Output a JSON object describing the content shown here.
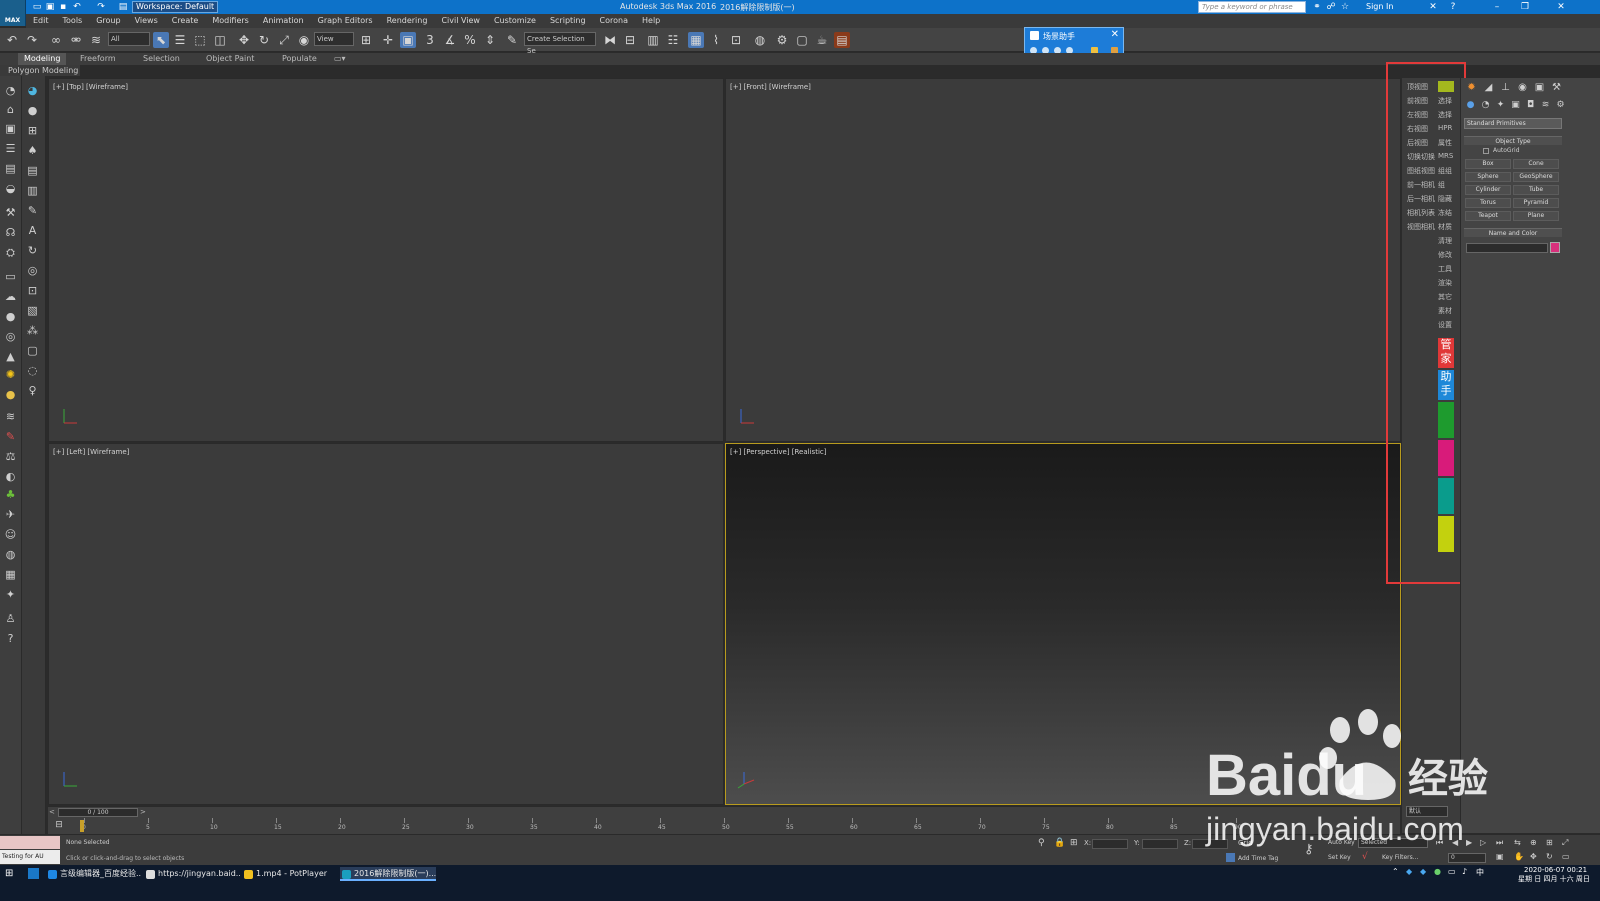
{
  "title_bar": {
    "app_name": "Autodesk 3ds Max 2016",
    "file_name": "2016解除限制版(一)",
    "workspace": "Workspace: Default",
    "search_placeholder": "Type a keyword or phrase",
    "sign_in": "Sign In",
    "logo_text": "MAX"
  },
  "menu": [
    "Edit",
    "Tools",
    "Group",
    "Views",
    "Create",
    "Modifiers",
    "Animation",
    "Graph Editors",
    "Rendering",
    "Civil View",
    "Customize",
    "Scripting",
    "Corona",
    "Help"
  ],
  "toolbar": {
    "selection_filter": "All",
    "reference_coord": "View",
    "named_selection": "Create Selection Se",
    "snap_label": "3"
  },
  "scene_helper": {
    "title": "场景助手"
  },
  "ribbon": {
    "tabs": [
      "Modeling",
      "Freeform",
      "Selection",
      "Object Paint",
      "Populate"
    ],
    "active_tab": "Modeling",
    "sub_label": "Polygon Modeling"
  },
  "viewports": {
    "top": "[+] [Top] [Wireframe]",
    "front": "[+] [Front] [Wireframe]",
    "left": "[+] [Left] [Wireframe]",
    "perspective": "[+] [Perspective] [Realistic]"
  },
  "extension_panel": {
    "views": [
      "顶视图",
      "前视图",
      "左视图",
      "右视图",
      "后视图",
      "切换切换",
      "图纸视图",
      "前一相机",
      "后一相机",
      "相机列表",
      "视图相机"
    ],
    "tools": [
      "选择",
      "选择",
      "HPR",
      "属性",
      "MRS",
      "组组",
      "组",
      "隐藏",
      "冻结",
      "材质",
      "清理",
      "修改",
      "工具",
      "渲染",
      "其它",
      "素材",
      "设置"
    ],
    "badge_top": "管家",
    "badge_bottom": "助手",
    "colors": [
      "#1e9b2e",
      "#d81b7a",
      "#0a9c8c",
      "#c3d10e"
    ]
  },
  "command_panel": {
    "dropdown": "Standard Primitives",
    "object_type_title": "Object Type",
    "autogrid": "AutoGrid",
    "objects": [
      "Box",
      "Cone",
      "Sphere",
      "GeoSphere",
      "Cylinder",
      "Tube",
      "Torus",
      "Pyramid",
      "Teapot",
      "Plane"
    ],
    "name_color_title": "Name and Color",
    "object_color": "#d8307c"
  },
  "timeline": {
    "frame_display": "0 / 100",
    "ticks": [
      "0",
      "5",
      "10",
      "15",
      "20",
      "25",
      "30",
      "35",
      "40",
      "45",
      "50",
      "55",
      "60",
      "65",
      "70",
      "75",
      "80",
      "85",
      "90"
    ],
    "view_dropdown": "默认"
  },
  "status": {
    "selected": "None Selected",
    "prompt": "Click or click-and-drag to select objects",
    "script_label": "Testing for AU",
    "x": "X:",
    "y": "Y:",
    "z": "Z:",
    "grid": "Grid",
    "auto_key": "Auto Key",
    "set_key": "Set Key",
    "key_filters": "Key Filters...",
    "selected_dropdown": "Selected",
    "add_time_tag": "Add Time Tag",
    "frame_field": "0"
  },
  "taskbar": {
    "items": [
      "言级编辑器_百度经验...",
      "https://jingyan.baid...",
      "1.mp4 - PotPlayer",
      "2016解除限制版(一)..."
    ],
    "time": "2020-06-07  00:21",
    "date": "星期 日 四月 十六 周日"
  },
  "watermark": {
    "brand": "Baidu",
    "suffix": "经验",
    "url": "jingyan.baidu.com"
  }
}
